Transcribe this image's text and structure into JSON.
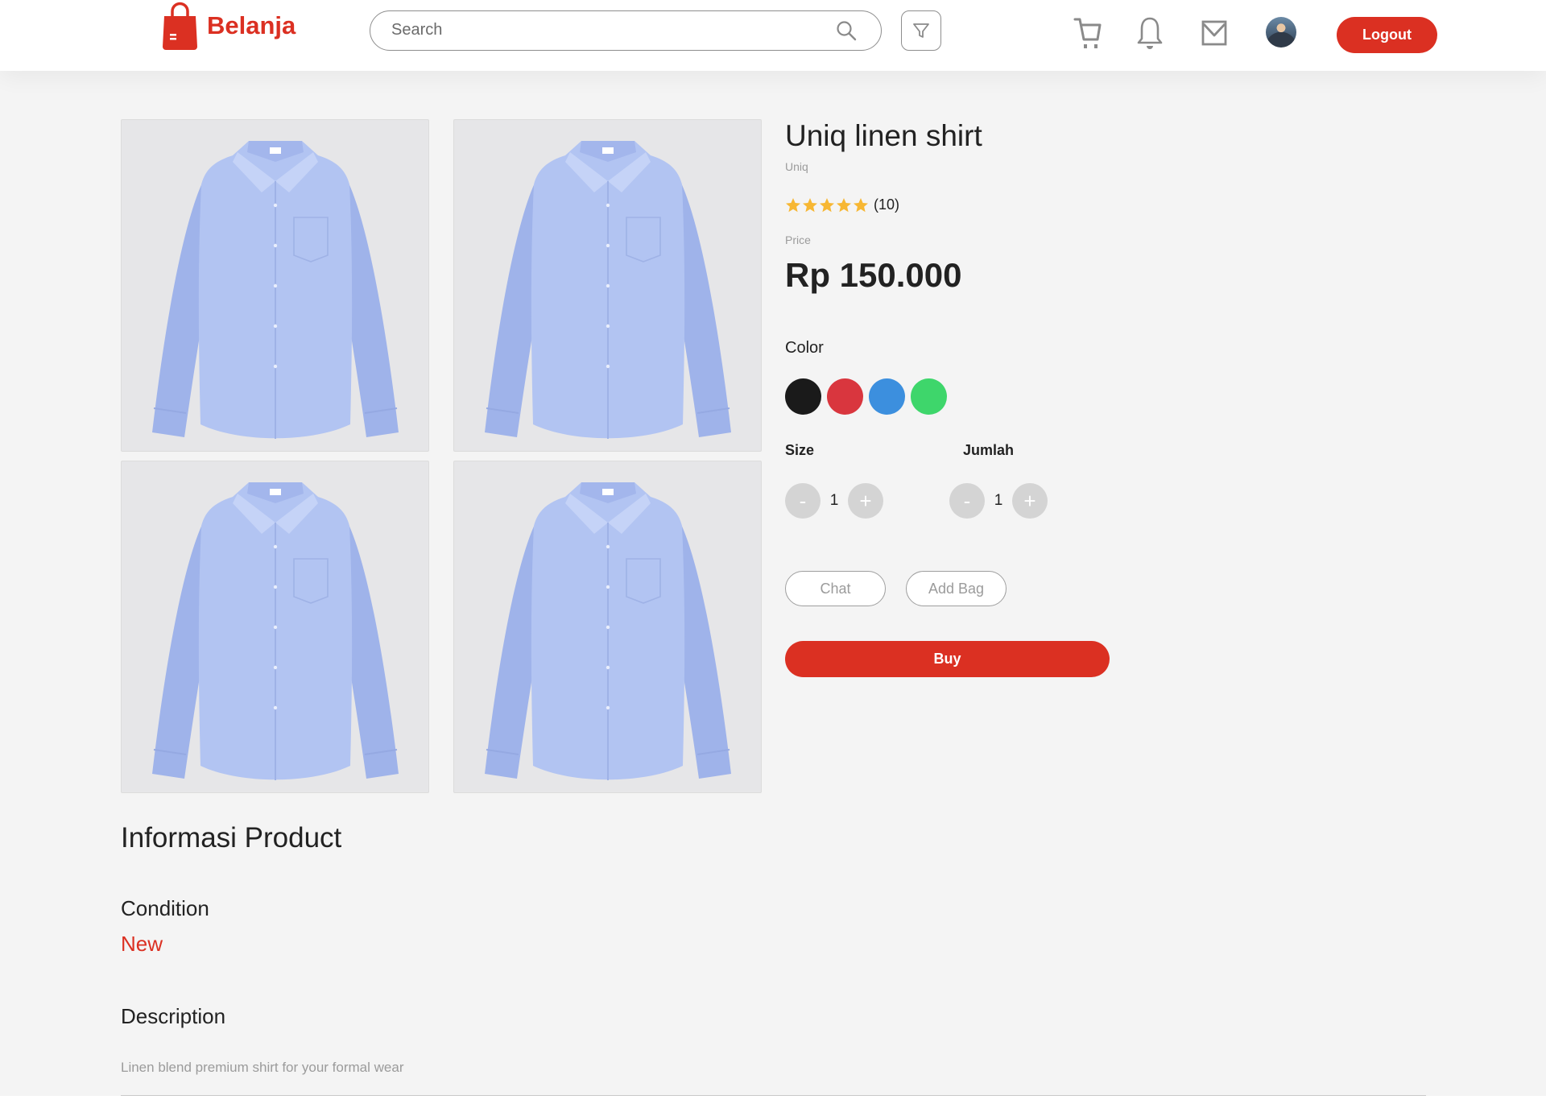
{
  "header": {
    "brand": "Belanja",
    "search_placeholder": "Search",
    "logout_label": "Logout",
    "icons": [
      "search-icon",
      "filter-icon",
      "cart-icon",
      "bell-icon",
      "mail-icon",
      "avatar"
    ],
    "accent_color": "#db3022"
  },
  "gallery": {
    "images": [
      "shirt-image",
      "shirt-image",
      "shirt-image",
      "shirt-image"
    ]
  },
  "product": {
    "name": "Uniq linen shirt",
    "brand": "Uniq",
    "rating_stars": 5,
    "rating_count": "(10)",
    "price_label": "Price",
    "price": "Rp 150.000",
    "color_label": "Color",
    "colors": [
      "#1a1a1a",
      "#d9363e",
      "#3c8fde",
      "#3ed66b"
    ],
    "size_label": "Size",
    "size_value": "1",
    "qty_label": "Jumlah",
    "qty_value": "1",
    "minus_label": "-",
    "plus_label": "+",
    "chat_label": "Chat",
    "add_bag_label": "Add Bag",
    "buy_label": "Buy"
  },
  "info": {
    "title": "Informasi Product",
    "condition_label": "Condition",
    "condition_value": "New",
    "description_label": "Description",
    "description_text": "Linen blend premium shirt for your formal wear"
  }
}
